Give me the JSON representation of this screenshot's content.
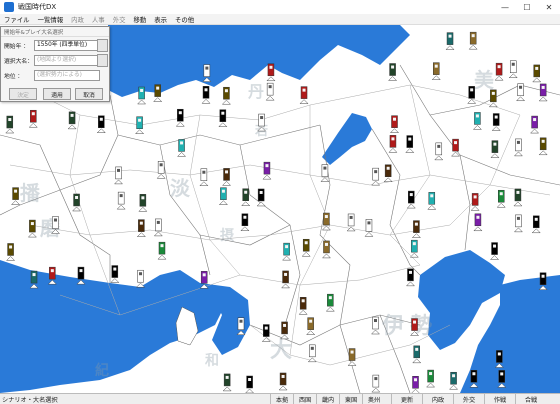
{
  "window": {
    "title": "戦国時代DX",
    "minimize": "—",
    "maximize": "☐",
    "close": "✕"
  },
  "menu": [
    {
      "label": "ファイル",
      "enabled": true
    },
    {
      "label": "一覧情報",
      "enabled": true
    },
    {
      "label": "内政",
      "enabled": false
    },
    {
      "label": "人事",
      "enabled": false
    },
    {
      "label": "外交",
      "enabled": false
    },
    {
      "label": "移動",
      "enabled": true
    },
    {
      "label": "表示",
      "enabled": true
    },
    {
      "label": "その他",
      "enabled": true
    }
  ],
  "dialog": {
    "title": "開始年&プレイ大名選択",
    "start_year_label": "開始年 ：",
    "start_year_value": "1550年 (四季単位)",
    "daimyo_label": "選択大名：",
    "daimyo_placeholder": "(地図より選択)",
    "position_label": "地位 ：",
    "position_placeholder": "(選択勢力による)",
    "buttons": {
      "decide": "決定",
      "apply": "適用",
      "cancel": "取消"
    }
  },
  "map": {
    "background_color": "#ffffff",
    "sea_color": "#2a7ad8",
    "watermarks": [
      "丹",
      "若",
      "美",
      "播",
      "磨",
      "淡",
      "大",
      "伊",
      "勢",
      "和",
      "摂",
      "紀"
    ]
  },
  "statusbar": {
    "text": "シナリオ・大名選択",
    "left_tabs": [
      "本拠",
      "西国",
      "畿内",
      "東国",
      "奥州"
    ],
    "right_tabs": [
      "更新",
      "内政",
      "外交",
      "作戦",
      "合戦"
    ]
  }
}
